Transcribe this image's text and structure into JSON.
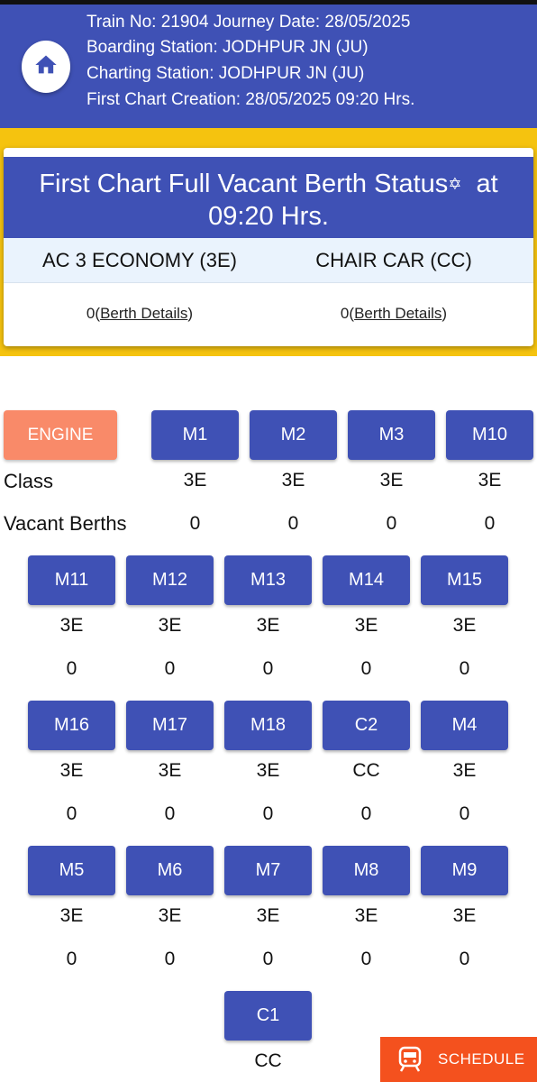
{
  "header": {
    "train_line": "Train No: 21904     Journey Date: 28/05/2025",
    "boarding": "Boarding Station: JODHPUR JN (JU)",
    "charting": "Charting Station: JODHPUR JN (JU)",
    "first_chart": "First Chart Creation: 28/05/2025 09:20 Hrs.",
    "home_icon": "home-icon"
  },
  "status_card": {
    "title_part1": "First Chart Full Vacant Berth Status",
    "star": "✡",
    "title_part2": " at 09:20 Hrs.",
    "classes": [
      {
        "name": "AC 3 ECONOMY (3E)",
        "count": "0",
        "link": "Berth Details"
      },
      {
        "name": "CHAIR CAR (CC)",
        "count": "0",
        "link": "Berth Details"
      }
    ]
  },
  "labels": {
    "engine": "ENGINE",
    "class": "Class",
    "vacant": "Vacant Berths"
  },
  "coaches": [
    {
      "name": "M1",
      "class": "3E",
      "vacant": "0"
    },
    {
      "name": "M2",
      "class": "3E",
      "vacant": "0"
    },
    {
      "name": "M3",
      "class": "3E",
      "vacant": "0"
    },
    {
      "name": "M10",
      "class": "3E",
      "vacant": "0"
    },
    {
      "name": "M11",
      "class": "3E",
      "vacant": "0"
    },
    {
      "name": "M12",
      "class": "3E",
      "vacant": "0"
    },
    {
      "name": "M13",
      "class": "3E",
      "vacant": "0"
    },
    {
      "name": "M14",
      "class": "3E",
      "vacant": "0"
    },
    {
      "name": "M15",
      "class": "3E",
      "vacant": "0"
    },
    {
      "name": "M16",
      "class": "3E",
      "vacant": "0"
    },
    {
      "name": "M17",
      "class": "3E",
      "vacant": "0"
    },
    {
      "name": "M18",
      "class": "3E",
      "vacant": "0"
    },
    {
      "name": "C2",
      "class": "CC",
      "vacant": "0"
    },
    {
      "name": "M4",
      "class": "3E",
      "vacant": "0"
    },
    {
      "name": "M5",
      "class": "3E",
      "vacant": "0"
    },
    {
      "name": "M6",
      "class": "3E",
      "vacant": "0"
    },
    {
      "name": "M7",
      "class": "3E",
      "vacant": "0"
    },
    {
      "name": "M8",
      "class": "3E",
      "vacant": "0"
    },
    {
      "name": "M9",
      "class": "3E",
      "vacant": "0"
    },
    {
      "name": "C1",
      "class": "CC",
      "vacant": ""
    }
  ],
  "schedule": {
    "label": "SCHEDULE",
    "icon": "train-icon"
  },
  "colors": {
    "primary": "#3f51b5",
    "band": "#f5c30f",
    "engine": "#f98a69",
    "schedule": "#f4511e"
  }
}
